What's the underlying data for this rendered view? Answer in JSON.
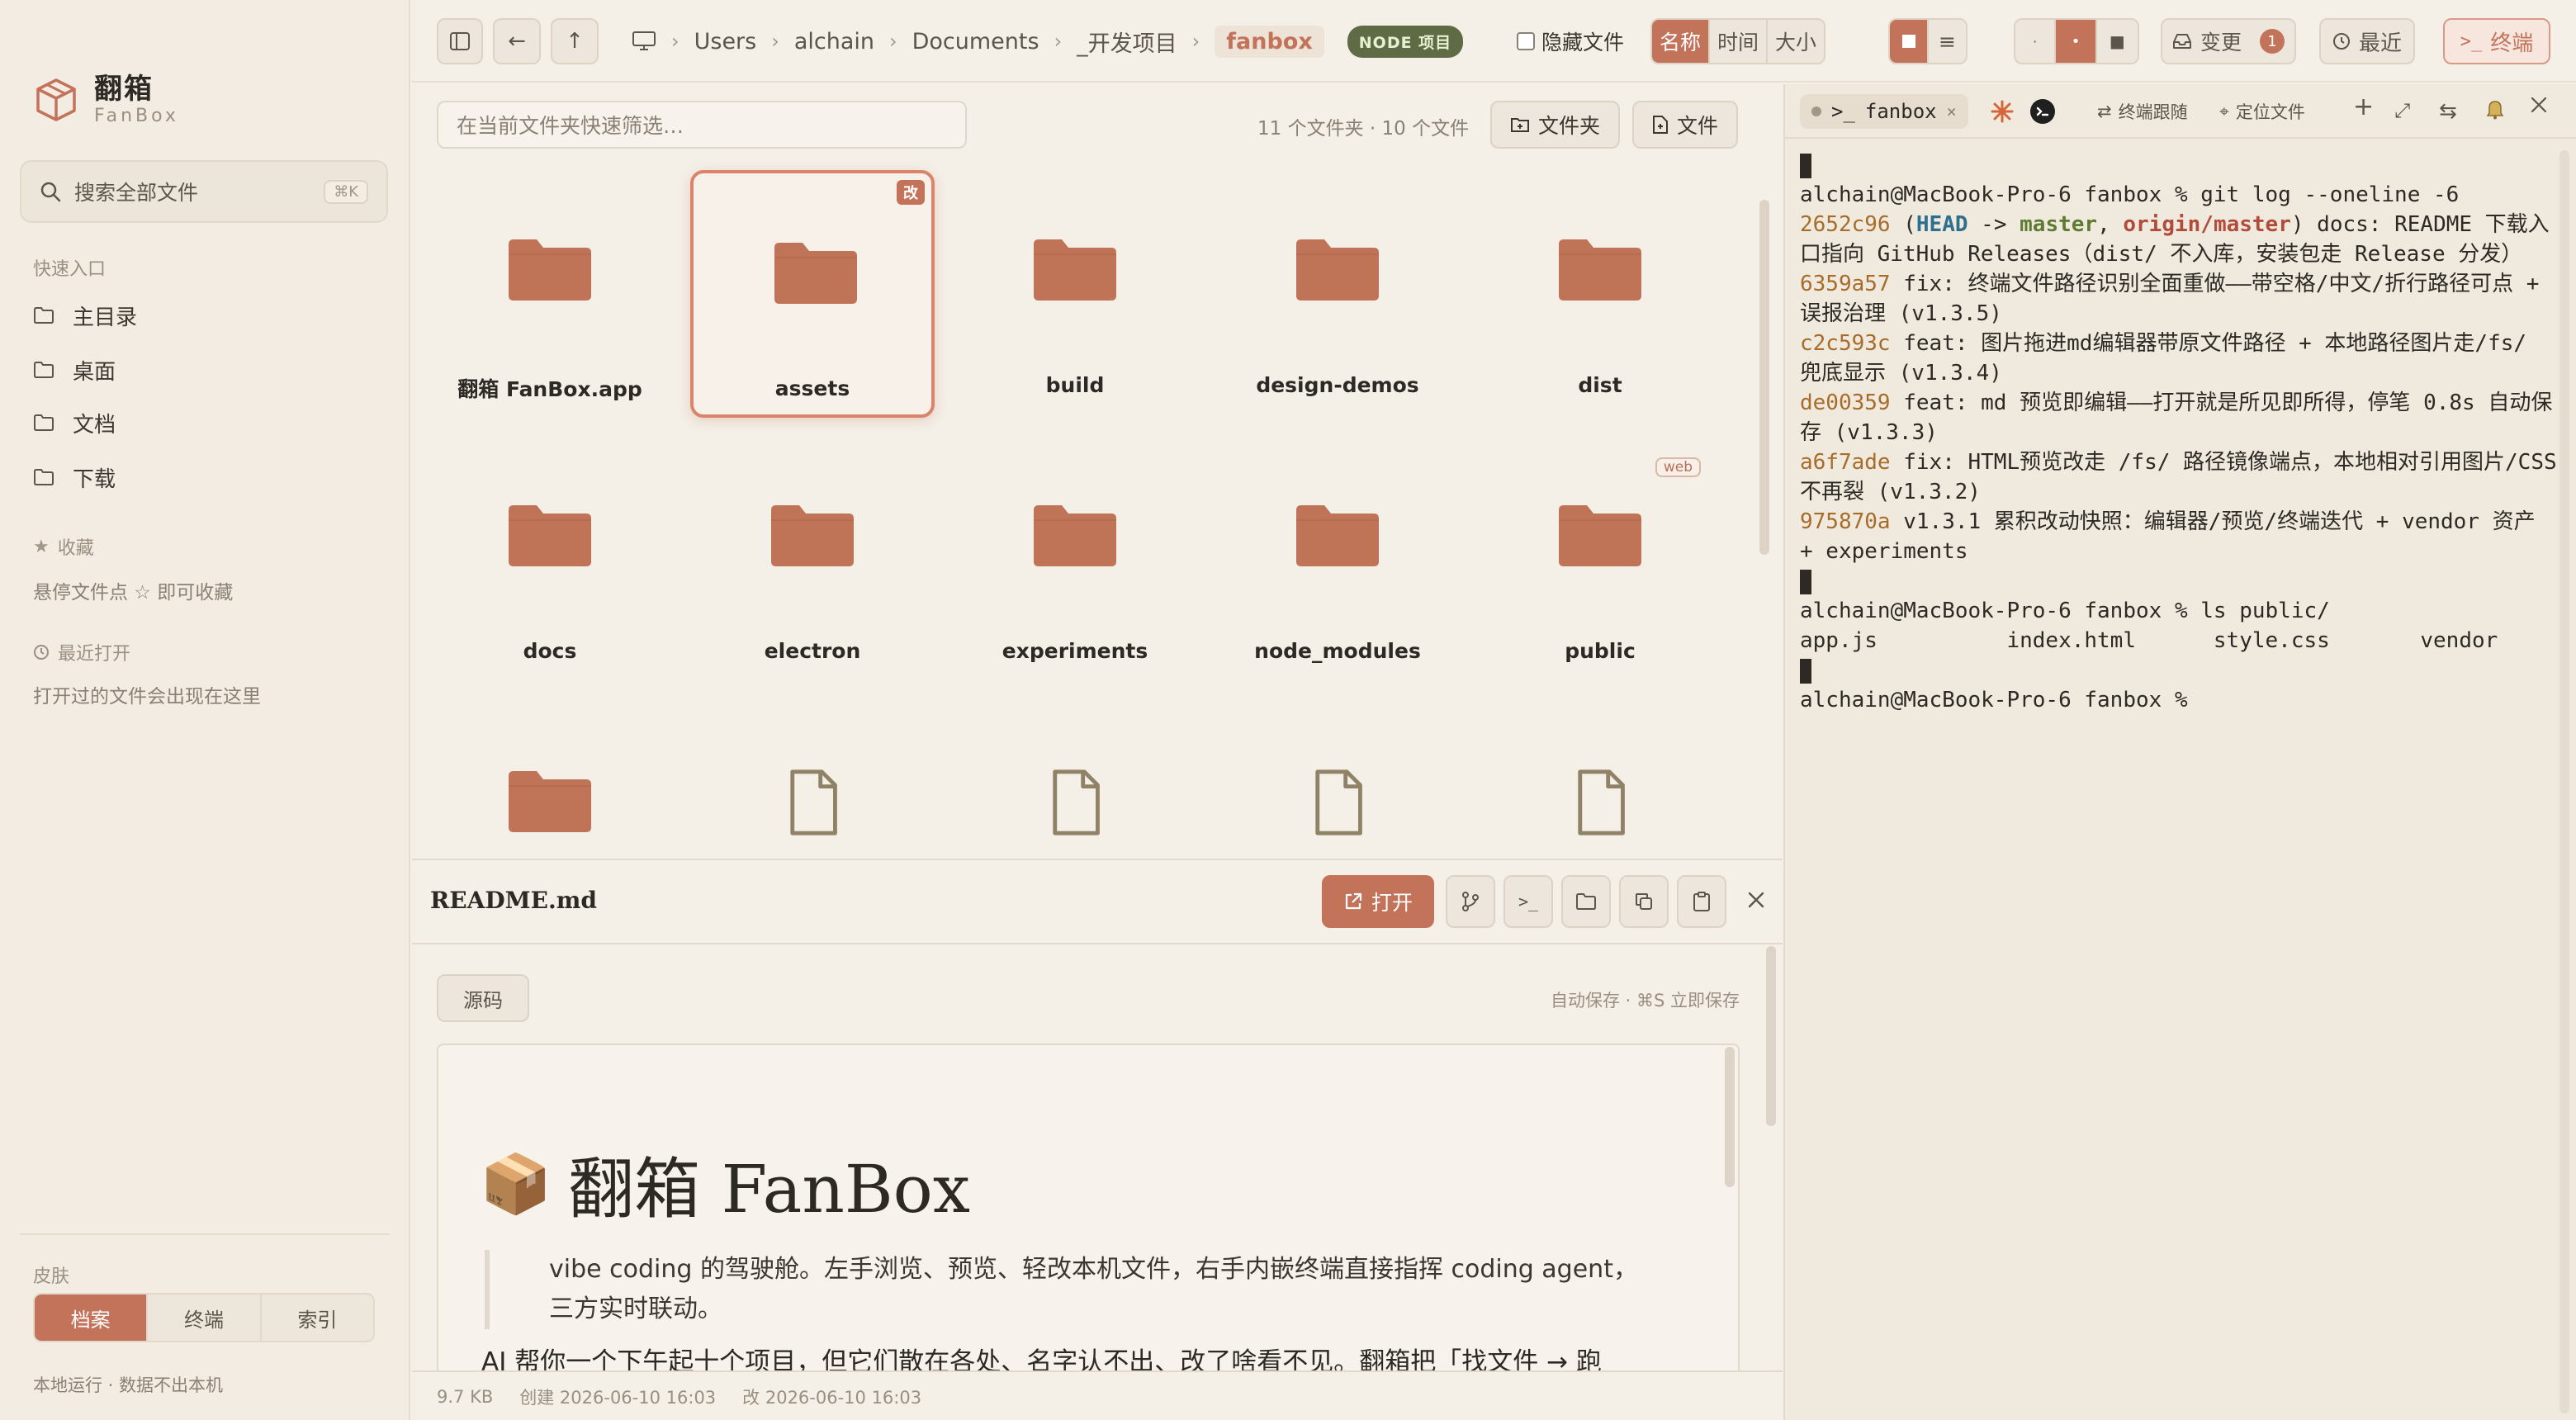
{
  "sidebar": {
    "brand_cn": "翻箱",
    "brand_en": "FanBox",
    "search_placeholder": "搜索全部文件",
    "search_shortcut": "⌘K",
    "quick_title": "快速入口",
    "quick_items": [
      {
        "label": "主目录",
        "icon": "folder-icon"
      },
      {
        "label": "桌面",
        "icon": "folder-icon"
      },
      {
        "label": "文档",
        "icon": "folder-icon"
      },
      {
        "label": "下载",
        "icon": "folder-icon"
      }
    ],
    "favorites_title": "收藏",
    "favorites_hint": "悬停文件点 ☆ 即可收藏",
    "recent_title": "最近打开",
    "recent_hint": "打开过的文件会出现在这里",
    "skin_title": "皮肤",
    "skins": [
      "档案",
      "终端",
      "索引"
    ],
    "skin_active": "档案",
    "footer": "本地运行 · 数据不出本机"
  },
  "toolbar": {
    "crumbs": [
      "Users",
      "alchain",
      "Documents",
      "_开发项目"
    ],
    "current": "fanbox",
    "badge": "NODE 项目",
    "hide_files": "隐藏文件",
    "sort": [
      "名称",
      "时间",
      "大小"
    ],
    "sort_active": "名称",
    "sizes": [
      "·",
      "•",
      "■"
    ],
    "changes_label": "变更",
    "changes_count": "1",
    "recent_label": "最近",
    "terminal_label": "终端"
  },
  "files": {
    "filter_placeholder": "在当前文件夹快速筛选…",
    "count_text": "11 个文件夹 · 10 个文件",
    "new_folder": "文件夹",
    "new_file": "文件",
    "items": [
      {
        "name": "翻箱 FanBox.app",
        "type": "folder"
      },
      {
        "name": "assets",
        "type": "folder",
        "selected": true,
        "tag": "改"
      },
      {
        "name": "build",
        "type": "folder"
      },
      {
        "name": "design-demos",
        "type": "folder"
      },
      {
        "name": "dist",
        "type": "folder"
      },
      {
        "name": "docs",
        "type": "folder"
      },
      {
        "name": "electron",
        "type": "folder"
      },
      {
        "name": "experiments",
        "type": "folder"
      },
      {
        "name": "node_modules",
        "type": "folder"
      },
      {
        "name": "public",
        "type": "folder",
        "tag": "web"
      },
      {
        "name": "",
        "type": "folder"
      },
      {
        "name": "",
        "type": "file"
      },
      {
        "name": "",
        "type": "file"
      },
      {
        "name": "",
        "type": "file"
      },
      {
        "name": "",
        "type": "file"
      }
    ]
  },
  "preview": {
    "filename": "README.md",
    "open_label": "打开",
    "source_label": "源码",
    "autosave": "自动保存 · ⌘S 立即保存",
    "h1_emoji": "📦",
    "h1_text": "翻箱 FanBox",
    "quote": "vibe coding 的驾驶舱。左手浏览、预览、轻改本机文件，右手内嵌终端直接指挥 coding agent，三方实时联动。",
    "para": "AI 帮你一个下午起十个项目，但它们散在各处、名字认不出、改了啥看不见。翻箱把「找文件 → 跑",
    "size": "9.7 KB",
    "created": "创建 2026-06-10 16:03",
    "modified": "改 2026-06-10 16:03"
  },
  "terminal": {
    "tab_name": "fanbox",
    "follow": "终端跟随",
    "locate": "定位文件",
    "lines": [
      {
        "kind": "cursor"
      },
      {
        "kind": "text",
        "text": "alchain@MacBook-Pro-6 fanbox % git log --oneline -6"
      },
      {
        "kind": "commit",
        "hash": "2652c96",
        "refs": true,
        "msg": " docs: README 下载入口指向 GitHub Releases（dist/ 不入库，安装包走 Release 分发）"
      },
      {
        "kind": "commit",
        "hash": "6359a57",
        "msg": " fix: 终端文件路径识别全面重做——带空格/中文/折行路径可点 + 误报治理 (v1.3.5)"
      },
      {
        "kind": "commit",
        "hash": "c2c593c",
        "msg": " feat: 图片拖进md编辑器带原文件路径 + 本地路径图片走/fs/ 兜底显示 (v1.3.4)"
      },
      {
        "kind": "commit",
        "hash": "de00359",
        "msg": " feat: md 预览即编辑——打开就是所见即所得，停笔 0.8s 自动保存 (v1.3.3)"
      },
      {
        "kind": "commit",
        "hash": "a6f7ade",
        "msg": " fix: HTML预览改走 /fs/ 路径镜像端点，本地相对引用图片/CSS不再裂 (v1.3.2)"
      },
      {
        "kind": "commit",
        "hash": "975870a",
        "msg": " v1.3.1 累积改动快照：编辑器/预览/终端迭代 + vendor 资产 + experiments"
      },
      {
        "kind": "cursor"
      },
      {
        "kind": "text",
        "text": "alchain@MacBook-Pro-6 fanbox % ls public/"
      },
      {
        "kind": "text",
        "text": "app.js          index.html      style.css       vendor"
      },
      {
        "kind": "cursor"
      },
      {
        "kind": "text",
        "text": "alchain@MacBook-Pro-6 fanbox %"
      }
    ],
    "refs_head": "HEAD",
    "refs_arrow": " -> ",
    "refs_master": "master",
    "refs_origin": "origin/master"
  },
  "colors": {
    "accent": "#c2735a",
    "folder": "#c07457",
    "file_outline": "#8f8266"
  }
}
